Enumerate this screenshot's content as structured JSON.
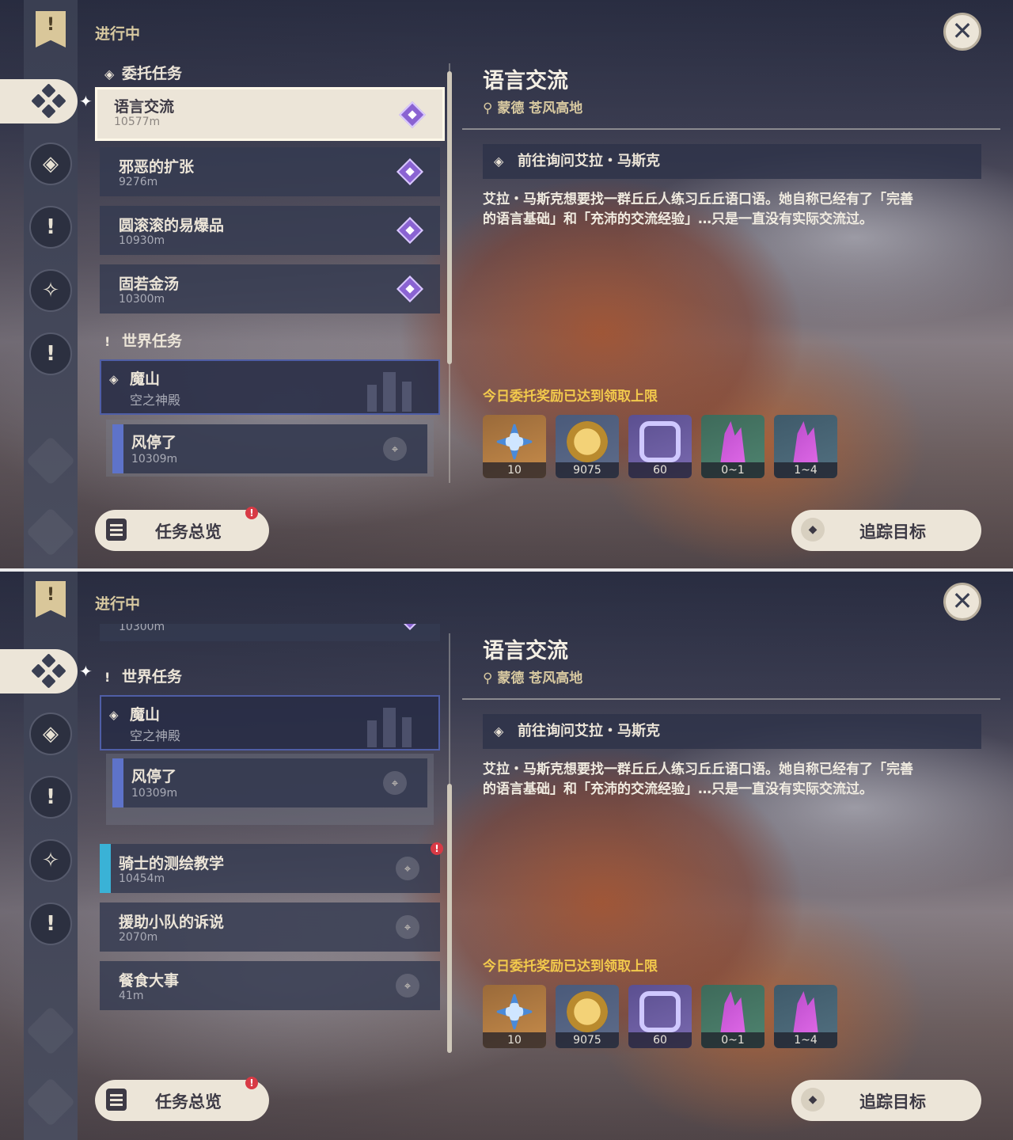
{
  "header": {
    "status": "进行中"
  },
  "sections": {
    "commission": "委托任务",
    "world": "世界任务"
  },
  "commissions": [
    {
      "title": "语言交流",
      "distance": "10577m"
    },
    {
      "title": "邪恶的扩张",
      "distance": "9276m"
    },
    {
      "title": "圆滚滚的易爆品",
      "distance": "10930m"
    },
    {
      "title": "固若金汤",
      "distance": "10300m"
    }
  ],
  "world_quest": {
    "title": "魔山",
    "subtitle": "空之神殿",
    "subquest": {
      "title": "风停了",
      "distance": "10309m"
    }
  },
  "world_quests_more": [
    {
      "title": "骑士的测绘教学",
      "distance": "10454m"
    },
    {
      "title": "援助小队的诉说",
      "distance": "2070m"
    },
    {
      "title": "餐食大事",
      "distance": "41m"
    }
  ],
  "detail": {
    "title": "语言交流",
    "location": "蒙德 苍风高地",
    "objective": "前往询问艾拉・马斯克",
    "description_line1": "艾拉・马斯克想要找一群丘丘人练习丘丘语口语。她自称已经有了「完善",
    "description_line2": "的语言基础」和「充沛的交流经验」…只是一直没有实际交流过。",
    "limit_notice": "今日委托奖励已达到领取上限",
    "rewards": [
      {
        "icon": "primogem-icon",
        "count": "10"
      },
      {
        "icon": "mora-icon",
        "count": "9075"
      },
      {
        "icon": "adventure-exp-icon",
        "count": "60"
      },
      {
        "icon": "crystal-icon",
        "count": "0~1"
      },
      {
        "icon": "crystal-cluster-icon",
        "count": "1~4"
      }
    ]
  },
  "buttons": {
    "overview": "任务总览",
    "track": "追踪目标",
    "alert": "!"
  },
  "colors": {
    "accent_gold": "#d8c9a0",
    "notice_yellow": "#f2c94c",
    "panel": "#ece5d8",
    "commission_star": "#8a63d2",
    "alert_red": "#d83a45"
  }
}
